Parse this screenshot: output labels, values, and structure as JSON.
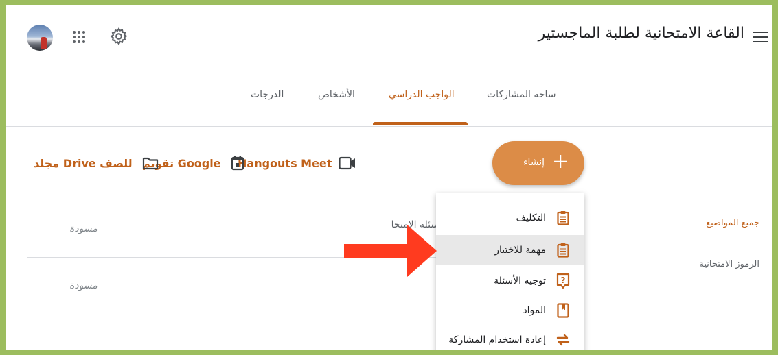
{
  "header": {
    "class_title": "القاعة الامتحانية لطلبة الماجستير",
    "icons": [
      "menu-icon",
      "apps-icon",
      "gear-icon"
    ]
  },
  "tabs": [
    {
      "label": "ساحة المشاركات",
      "active": false
    },
    {
      "label": "الواجب الدراسي",
      "active": true
    },
    {
      "label": "الأشخاص",
      "active": false
    },
    {
      "label": "الدرجات",
      "active": false
    }
  ],
  "create": {
    "label": "إنشاء",
    "icon": "plus-icon"
  },
  "toolbar": {
    "meet": "Hangouts Meet",
    "calendar": "تقويم Google",
    "drive": "مجلد Drive للصف"
  },
  "topics": {
    "all": "جميع المواضيع",
    "codes": "الرموز الامتحانية"
  },
  "list": {
    "partial_label": "أسئلة الامتحانية",
    "drafts": [
      "مسودة",
      "مسودة"
    ]
  },
  "menu": {
    "items": [
      {
        "label": "التكليف",
        "icon": "assignment-icon"
      },
      {
        "label": "مهمة للاختبار",
        "icon": "quiz-assignment-icon",
        "highlighted": true
      },
      {
        "label": "توجيه الأسئلة",
        "icon": "question-icon"
      },
      {
        "label": "المواد",
        "icon": "material-icon"
      },
      {
        "label": "إعادة استخدام المشاركة",
        "icon": "reuse-post-icon"
      }
    ]
  },
  "colors": {
    "accent": "#c0611a",
    "create_button": "#dc8c47",
    "annotation_arrow": "#ff3b1f",
    "border_frame": "#9cbd5e"
  }
}
